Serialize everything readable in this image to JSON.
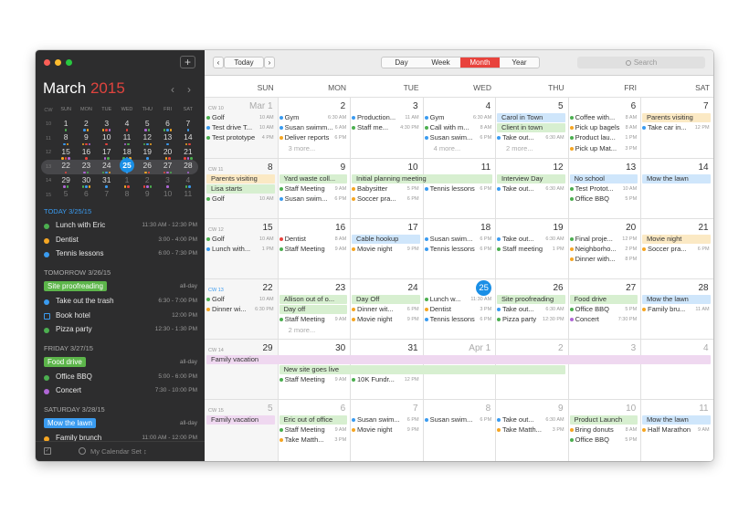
{
  "sidebar": {
    "add_label": "+",
    "month_name": "March",
    "year": "2015",
    "prev_arrow": "‹",
    "next_arrow": "›",
    "mini_headers": [
      "CW",
      "SUN",
      "MON",
      "TUE",
      "WED",
      "THU",
      "FRI",
      "SAT"
    ],
    "mini_weeks": [
      {
        "cw": "10",
        "days": [
          "1",
          "2",
          "3",
          "4",
          "5",
          "6",
          "7"
        ]
      },
      {
        "cw": "11",
        "days": [
          "8",
          "9",
          "10",
          "11",
          "12",
          "13",
          "14"
        ]
      },
      {
        "cw": "12",
        "days": [
          "15",
          "16",
          "17",
          "18",
          "19",
          "20",
          "21"
        ]
      },
      {
        "cw": "13",
        "days": [
          "22",
          "23",
          "24",
          "25",
          "26",
          "27",
          "28"
        ]
      },
      {
        "cw": "14",
        "days": [
          "29",
          "30",
          "31",
          "1",
          "2",
          "3",
          "4"
        ]
      },
      {
        "cw": "15",
        "days": [
          "5",
          "6",
          "7",
          "8",
          "9",
          "10",
          "11"
        ]
      }
    ],
    "agenda": [
      {
        "header": "TODAY 3/25/15",
        "items": [
          {
            "title": "Lunch with Eric",
            "time": "11:30 AM - 12:30 PM",
            "color": "#4caf50"
          },
          {
            "title": "Dentist",
            "time": "3:00 - 4:00 PM",
            "color": "#f5a623"
          },
          {
            "title": "Tennis lessons",
            "time": "6:00 - 7:30 PM",
            "color": "#3a9bf0"
          }
        ]
      },
      {
        "header": "TOMORROW 3/26/15",
        "items": [
          {
            "title": "Site proofreading",
            "time": "all-day",
            "pill": "#5cb54a"
          },
          {
            "title": "Take out the trash",
            "time": "6:30 - 7:00 PM",
            "color": "#3a9bf0"
          },
          {
            "title": "Book hotel",
            "time": "12:00 PM",
            "square": true
          },
          {
            "title": "Pizza party",
            "time": "12:30 - 1:30 PM",
            "color": "#4caf50"
          }
        ]
      },
      {
        "header": "FRIDAY 3/27/15",
        "items": [
          {
            "title": "Food drive",
            "time": "all-day",
            "pill": "#5cb54a"
          },
          {
            "title": "Office BBQ",
            "time": "5:00 - 6:00 PM",
            "color": "#4caf50"
          },
          {
            "title": "Concert",
            "time": "7:30 - 10:00 PM",
            "color": "#b067d6"
          }
        ]
      },
      {
        "header": "SATURDAY 3/28/15",
        "items": [
          {
            "title": "Mow the lawn",
            "time": "all-day",
            "pill": "#3a9bf0"
          },
          {
            "title": "Family brunch",
            "time": "11:00 AM - 12:00 PM",
            "color": "#f5a623"
          }
        ]
      }
    ],
    "calendar_set": "My Calendar Set ↕"
  },
  "toolbar": {
    "prev": "‹",
    "today": "Today",
    "next": "›",
    "views": [
      "Day",
      "Week",
      "Month",
      "Year"
    ],
    "active_view": "Month",
    "search_placeholder": "Search"
  },
  "grid": {
    "day_headers": [
      "SUN",
      "MON",
      "TUE",
      "WED",
      "THU",
      "FRI",
      "SAT"
    ],
    "weeks": [
      {
        "cw": "CW 10",
        "days": [
          {
            "num": "Mar 1",
            "dim": true,
            "events": [
              {
                "n": "Golf",
                "t": "10 AM",
                "c": "#4caf50"
              },
              {
                "n": "Test drive T...",
                "t": "10 AM",
                "c": "#3a9bf0"
              },
              {
                "n": "Test prototype",
                "t": "4 PM",
                "c": "#4caf50"
              }
            ]
          },
          {
            "num": "2",
            "events": [
              {
                "n": "Gym",
                "t": "6:30 AM",
                "c": "#3a9bf0"
              },
              {
                "n": "Susan swimm...",
                "t": "6 AM",
                "c": "#3a9bf0"
              },
              {
                "n": "Deliver reports",
                "t": "6 PM",
                "c": "#f5a623"
              },
              {
                "n": "3 more...",
                "more": true
              }
            ]
          },
          {
            "num": "3",
            "events": [
              {
                "n": "Production...",
                "t": "11 AM",
                "c": "#3a9bf0"
              },
              {
                "n": "Staff me...",
                "t": "4:30 PM",
                "c": "#4caf50"
              }
            ]
          },
          {
            "num": "4",
            "events": [
              {
                "n": "Gym",
                "t": "6:30 AM",
                "c": "#3a9bf0"
              },
              {
                "n": "Call with m...",
                "t": "8 AM",
                "c": "#4caf50"
              },
              {
                "n": "Susan swim...",
                "t": "6 PM",
                "c": "#3a9bf0"
              },
              {
                "n": "4 more...",
                "more": true
              }
            ]
          },
          {
            "num": "5",
            "events": [
              {
                "blk": "Carol in Town",
                "bg": "#cfe6fb"
              },
              {
                "blk": "Client in town",
                "bg": "#d7efd0"
              },
              {
                "n": "Take out...",
                "t": "6:30 AM",
                "c": "#3a9bf0"
              },
              {
                "n": "2 more...",
                "more": true
              }
            ]
          },
          {
            "num": "6",
            "events": [
              {
                "n": "Coffee with...",
                "t": "8 AM",
                "c": "#4caf50"
              },
              {
                "n": "Pick up bagels",
                "t": "8 AM",
                "c": "#f5a623"
              },
              {
                "n": "Product lau...",
                "t": "1 PM",
                "c": "#4caf50"
              },
              {
                "n": "Pick up Mat...",
                "t": "3 PM",
                "c": "#f5a623"
              }
            ]
          },
          {
            "num": "7",
            "events": [
              {
                "blk": "Parents visiting",
                "bg": "#fbe9c4"
              },
              {
                "n": "Take car in...",
                "t": "12 PM",
                "c": "#3a9bf0"
              }
            ]
          }
        ]
      },
      {
        "cw": "CW 11",
        "days": [
          {
            "num": "8",
            "events": [
              {
                "blk": "Parents visiting",
                "bg": "#fbe9c4"
              },
              {
                "blk": "Lisa starts",
                "bg": "#d7efd0"
              },
              {
                "n": "Golf",
                "t": "10 AM",
                "c": "#4caf50"
              }
            ]
          },
          {
            "num": "9",
            "events": [
              {
                "blk": "Yard waste coll...",
                "bg": "#d7efd0"
              },
              {
                "n": "Staff Meeting",
                "t": "9 AM",
                "c": "#4caf50"
              },
              {
                "n": "Susan swim...",
                "t": "6 PM",
                "c": "#3a9bf0"
              }
            ]
          },
          {
            "num": "10",
            "events": [
              {
                "n": "",
                "t": ""
              },
              {
                "n": "Babysitter",
                "t": "5 PM",
                "c": "#f5a623"
              },
              {
                "n": "Soccer pra...",
                "t": "6 PM",
                "c": "#f5a623"
              }
            ]
          },
          {
            "num": "11",
            "events": [
              {
                "n": "",
                "t": ""
              },
              {
                "n": "Tennis lessons",
                "t": "6 PM",
                "c": "#3a9bf0"
              }
            ]
          },
          {
            "num": "12",
            "events": [
              {
                "blk": "Interview Day",
                "bg": "#d7efd0"
              },
              {
                "n": "Take out...",
                "t": "6:30 AM",
                "c": "#3a9bf0"
              }
            ]
          },
          {
            "num": "13",
            "events": [
              {
                "blk": "No school",
                "bg": "#cfe6fb"
              },
              {
                "n": "Test Protot...",
                "t": "10 AM",
                "c": "#4caf50"
              },
              {
                "n": "Office BBQ",
                "t": "5 PM",
                "c": "#4caf50"
              }
            ]
          },
          {
            "num": "14",
            "events": [
              {
                "blk": "Mow the lawn",
                "bg": "#cfe6fb"
              }
            ]
          }
        ]
      },
      {
        "cw": "CW 12",
        "days": [
          {
            "num": "15",
            "events": [
              {
                "n": "Golf",
                "t": "10 AM",
                "c": "#4caf50"
              },
              {
                "n": "Lunch with...",
                "t": "1 PM",
                "c": "#3a9bf0"
              }
            ]
          },
          {
            "num": "16",
            "events": [
              {
                "n": "Dentist",
                "t": "8 AM",
                "c": "#e8433d"
              },
              {
                "n": "Staff Meeting",
                "t": "9 AM",
                "c": "#4caf50"
              }
            ]
          },
          {
            "num": "17",
            "events": [
              {
                "blk": "Cable hookup",
                "bg": "#cfe6fb"
              },
              {
                "n": "Movie night",
                "t": "9 PM",
                "c": "#f5a623"
              }
            ]
          },
          {
            "num": "18",
            "events": [
              {
                "n": "Susan swim...",
                "t": "6 PM",
                "c": "#3a9bf0"
              },
              {
                "n": "Tennis lessons",
                "t": "6 PM",
                "c": "#3a9bf0"
              }
            ]
          },
          {
            "num": "19",
            "events": [
              {
                "n": "Take out...",
                "t": "6:30 AM",
                "c": "#3a9bf0"
              },
              {
                "n": "Staff meeting",
                "t": "1 PM",
                "c": "#4caf50"
              }
            ]
          },
          {
            "num": "20",
            "events": [
              {
                "n": "Final proje...",
                "t": "12 PM",
                "c": "#4caf50"
              },
              {
                "n": "Neighborho...",
                "t": "2 PM",
                "c": "#f5a623"
              },
              {
                "n": "Dinner with...",
                "t": "8 PM",
                "c": "#f5a623"
              }
            ]
          },
          {
            "num": "21",
            "events": [
              {
                "blk": "Movie night",
                "bg": "#fbe9c4"
              },
              {
                "n": "Soccer pra...",
                "t": "6 PM",
                "c": "#f5a623"
              }
            ]
          }
        ]
      },
      {
        "cw": "CW 13",
        "cwblue": true,
        "days": [
          {
            "num": "22",
            "events": [
              {
                "n": "Golf",
                "t": "10 AM",
                "c": "#4caf50"
              },
              {
                "n": "Dinner wi...",
                "t": "6:30 PM",
                "c": "#f5a623"
              }
            ]
          },
          {
            "num": "23",
            "events": [
              {
                "blk": "Allison out of o...",
                "bg": "#d7efd0"
              },
              {
                "blk": "Day off",
                "bg": "#d7efd0"
              },
              {
                "n": "Staff Meeting",
                "t": "9 AM",
                "c": "#4caf50"
              },
              {
                "n": "2 more...",
                "more": true
              }
            ]
          },
          {
            "num": "24",
            "events": [
              {
                "blk": "Day Off",
                "bg": "#d7efd0"
              },
              {
                "n": "Dinner wit...",
                "t": "6 PM",
                "c": "#f5a623"
              },
              {
                "n": "Movie night",
                "t": "9 PM",
                "c": "#f5a623"
              }
            ]
          },
          {
            "num": "25",
            "today": true,
            "events": [
              {
                "n": "Lunch w...",
                "t": "11:30 AM",
                "c": "#4caf50"
              },
              {
                "n": "Dentist",
                "t": "3 PM",
                "c": "#f5a623"
              },
              {
                "n": "Tennis lessons",
                "t": "6 PM",
                "c": "#3a9bf0"
              }
            ]
          },
          {
            "num": "26",
            "events": [
              {
                "blk": "Site proofreading",
                "bg": "#d7efd0"
              },
              {
                "n": "Take out...",
                "t": "6:30 AM",
                "c": "#3a9bf0"
              },
              {
                "n": "Pizza party",
                "t": "12:30 PM",
                "c": "#4caf50"
              }
            ]
          },
          {
            "num": "27",
            "events": [
              {
                "blk": "Food drive",
                "bg": "#d7efd0"
              },
              {
                "n": "Office BBQ",
                "t": "5 PM",
                "c": "#4caf50"
              },
              {
                "n": "Concert",
                "t": "7:30 PM",
                "c": "#b067d6"
              }
            ]
          },
          {
            "num": "28",
            "events": [
              {
                "blk": "Mow the lawn",
                "bg": "#cfe6fb"
              },
              {
                "n": "Family bru...",
                "t": "11 AM",
                "c": "#f5a623"
              }
            ]
          }
        ]
      },
      {
        "cw": "CW 14",
        "days": [
          {
            "num": "29",
            "events": []
          },
          {
            "num": "30",
            "events": [
              {
                "n": "",
                "t": ""
              },
              {
                "n": "",
                "t": ""
              },
              {
                "n": "Staff Meeting",
                "t": "9 AM",
                "c": "#4caf50"
              }
            ]
          },
          {
            "num": "31",
            "events": [
              {
                "n": "",
                "t": ""
              },
              {
                "n": "",
                "t": ""
              },
              {
                "n": "10K Fundr...",
                "t": "12 PM",
                "c": "#4caf50"
              }
            ]
          },
          {
            "num": "Apr 1",
            "dim": true,
            "events": []
          },
          {
            "num": "2",
            "dim": true,
            "events": []
          },
          {
            "num": "3",
            "dim": true,
            "events": []
          },
          {
            "num": "4",
            "dim": true,
            "events": []
          }
        ]
      },
      {
        "cw": "CW 15",
        "days": [
          {
            "num": "5",
            "dim": true,
            "events": [
              {
                "blk": "Family vacation",
                "bg": "#efd8f0"
              }
            ]
          },
          {
            "num": "6",
            "dim": true,
            "events": [
              {
                "blk": "Eric out of office",
                "bg": "#d7efd0"
              },
              {
                "n": "Staff Meeting",
                "t": "9 AM",
                "c": "#4caf50"
              },
              {
                "n": "Take Matth...",
                "t": "3 PM",
                "c": "#f5a623"
              }
            ]
          },
          {
            "num": "7",
            "dim": true,
            "events": [
              {
                "n": "Susan swim...",
                "t": "6 PM",
                "c": "#3a9bf0"
              },
              {
                "n": "Movie night",
                "t": "9 PM",
                "c": "#f5a623"
              }
            ]
          },
          {
            "num": "8",
            "dim": true,
            "events": [
              {
                "n": "Susan swim...",
                "t": "6 PM",
                "c": "#3a9bf0"
              }
            ]
          },
          {
            "num": "9",
            "dim": true,
            "events": [
              {
                "n": "Take out...",
                "t": "6:30 AM",
                "c": "#3a9bf0"
              },
              {
                "n": "Take Matth...",
                "t": "3 PM",
                "c": "#f5a623"
              }
            ]
          },
          {
            "num": "10",
            "dim": true,
            "events": [
              {
                "blk": "Product Launch",
                "bg": "#d7efd0"
              },
              {
                "n": "Bring donuts",
                "t": "8 AM",
                "c": "#f5a623"
              },
              {
                "n": "Office BBQ",
                "t": "5 PM",
                "c": "#4caf50"
              }
            ]
          },
          {
            "num": "11",
            "dim": true,
            "events": [
              {
                "blk": "Mow the lawn",
                "bg": "#cfe6fb"
              },
              {
                "n": "Half Marathon",
                "t": "9 AM",
                "c": "#f5a623"
              }
            ]
          }
        ]
      }
    ],
    "spans": [
      {
        "week": 1,
        "from": 2,
        "to": 3,
        "title": "Initial planning meeting",
        "bg": "#d7efd0"
      },
      {
        "week": 4,
        "from": 0,
        "to": 6,
        "title": "Family vacation",
        "bg": "#efd8f0"
      },
      {
        "week": 4,
        "from": 1,
        "to": 4,
        "row": 1,
        "title": "New site goes live",
        "bg": "#d7efd0"
      }
    ]
  }
}
